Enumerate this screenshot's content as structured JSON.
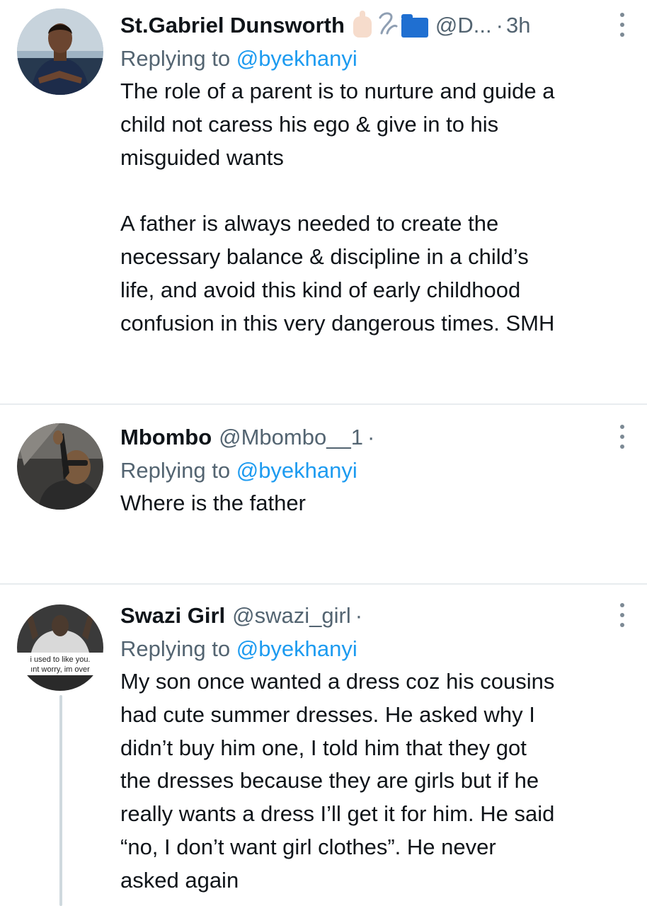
{
  "tweets": [
    {
      "name": "St.Gabriel Dunsworth",
      "handle": "@D...",
      "dot": "·",
      "time": "3h",
      "replying_prefix": "Replying to ",
      "replying_to": "@byekhanyi",
      "paragraphs": [
        [
          "The role of a parent is to nurture and guide a",
          "child not caress his ego &  give in to his",
          "misguided wants"
        ],
        [
          "A father is always needed to create the",
          "necessary balance & discipline in a child’s",
          "life, and avoid this kind of early childhood",
          "confusion in this very dangerous times. SMH"
        ]
      ],
      "header_icons": [
        "raised-finger-emoji-icon",
        "hook-symbol-icon",
        "folder-emoji-icon"
      ],
      "avatar_icon": "user-photo-icon"
    },
    {
      "name": "Mbombo",
      "handle": "@Mbombo__1",
      "dot": "·",
      "replying_prefix": "Replying to ",
      "replying_to": "@byekhanyi",
      "paragraphs": [
        [
          "Where is the father"
        ]
      ],
      "avatar_icon": "user-photo-icon"
    },
    {
      "name": "Swazi Girl",
      "handle": "@swazi_girl",
      "dot": "·",
      "replying_prefix": "Replying to ",
      "replying_to": "@byekhanyi",
      "paragraphs": [
        [
          "My son once wanted a dress coz his cousins",
          "had cute summer dresses. He asked why I",
          "didn’t buy him one, I told him that they got",
          "the dresses because they are girls but if he",
          "really wants a dress I’ll get it for him. He said",
          "“no, I don’t want girl clothes”. He never",
          "asked again"
        ]
      ],
      "avatar_caption": [
        "i used to like you.",
        "ınt worry, im over"
      ],
      "avatar_icon": "meme-photo-icon"
    }
  ],
  "icons": {
    "more": "more-vertical-icon"
  },
  "colors": {
    "link": "#1d9bf0",
    "secondary": "#536471",
    "text": "#0f1419",
    "divider": "#e8ecef",
    "thread": "#cfd9de"
  }
}
